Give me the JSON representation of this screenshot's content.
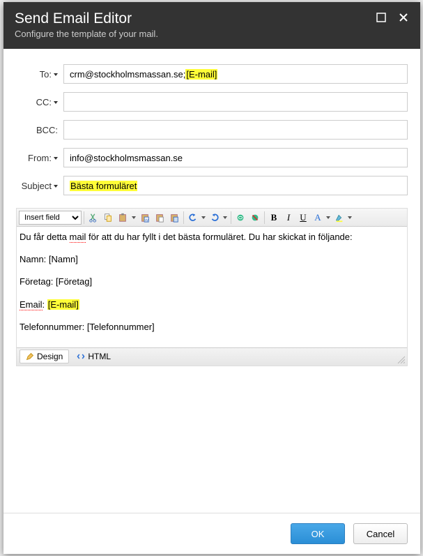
{
  "header": {
    "title": "Send Email Editor",
    "subtitle": "Configure the template of your mail."
  },
  "fields": {
    "to_label": "To:",
    "to_value_plain": "crm@stockholmsmassan.se;",
    "to_value_hl": "[E-mail]",
    "cc_label": "CC:",
    "cc_value": "",
    "bcc_label": "BCC:",
    "bcc_value": "",
    "from_label": "From:",
    "from_value": "info@stockholmsmassan.se",
    "subject_label": "Subject",
    "subject_hl": "Bästa formuläret"
  },
  "toolbar": {
    "insert_field": "Insert field"
  },
  "body": {
    "line1a": "Du får detta ",
    "line1b_spell": "mail",
    "line1c": " för att du har fyllt i det bästa formuläret. Du har skickat in följande:",
    "line2": "Namn: [Namn]",
    "line3": "Företag: [Företag]",
    "line4a_spell": "Email",
    "line4b": ": ",
    "line4c_hl": "[E-mail]",
    "line5": "Telefonnummer: [Telefonnummer]"
  },
  "tabs": {
    "design": "Design",
    "html": "HTML"
  },
  "buttons": {
    "ok": "OK",
    "cancel": "Cancel"
  }
}
